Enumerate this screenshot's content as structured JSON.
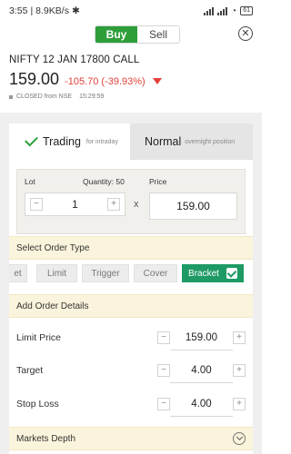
{
  "status_bar": {
    "time": "3:55",
    "speed": "8.9KB/s",
    "battery": "61"
  },
  "header": {
    "buy_label": "Buy",
    "sell_label": "Sell"
  },
  "instrument": {
    "symbol": "NIFTY 12 JAN 17800 CALL",
    "ltp": "159.00",
    "change": "-105.70 (-39.93%)",
    "market_status": "CLOSED from NSE",
    "timestamp": "15:29:59"
  },
  "tabs": [
    {
      "title": "Trading",
      "subtitle": "for intraday"
    },
    {
      "title": "Normal",
      "subtitle": "overnight position"
    }
  ],
  "quantity": {
    "lot_label": "Lot",
    "quantity_label": "Quantity: 50",
    "lot_value": "1",
    "times": "x",
    "price_label": "Price",
    "price_value": "159.00"
  },
  "order_type": {
    "section_title": "Select Order Type",
    "options": [
      "et",
      "Limit",
      "Trigger",
      "Cover",
      "Bracket"
    ],
    "selected": "Bracket"
  },
  "order_details": {
    "section_title": "Add Order Details",
    "rows": [
      {
        "label": "Limit Price",
        "value": "159.00"
      },
      {
        "label": "Target",
        "value": "4.00"
      },
      {
        "label": "Stop Loss",
        "value": "4.00"
      }
    ]
  },
  "markets_depth": {
    "title": "Markets Depth"
  },
  "colors": {
    "buy": "#2e9e3a",
    "loss": "#e0413b",
    "accent": "#1e9a65",
    "section_bg": "#fbf4dc"
  },
  "icons": {
    "close": "close-circle-icon",
    "check": "check-icon",
    "chevron": "chevron-down-icon"
  }
}
